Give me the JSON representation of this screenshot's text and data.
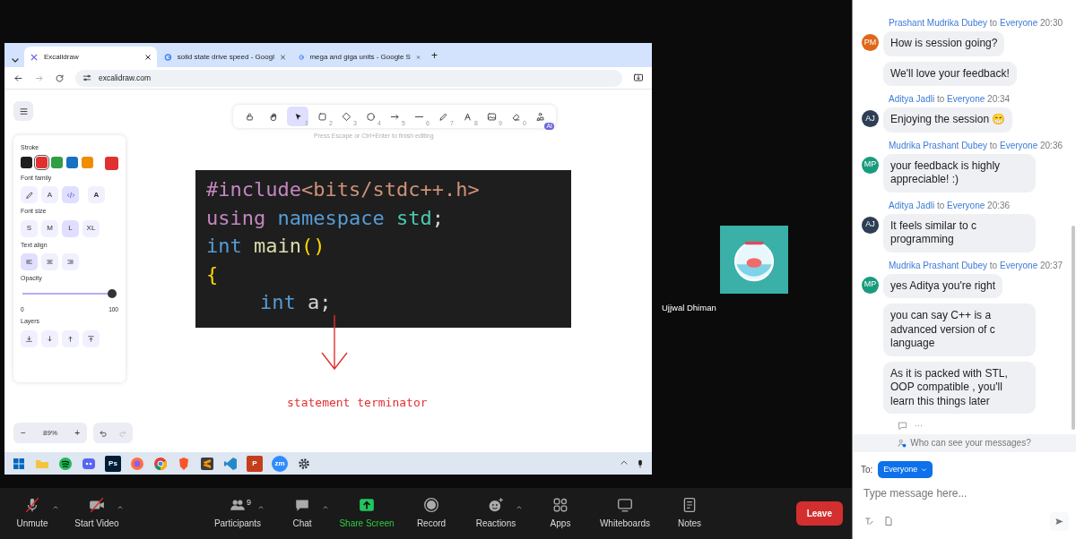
{
  "shared_screen": {
    "browser": {
      "tabs": [
        {
          "title": "Excalidraw",
          "selected": true
        },
        {
          "title": "solid state drive speed - Googl",
          "selected": false
        },
        {
          "title": "mega and giga units - Google S",
          "selected": false
        }
      ],
      "new_tab": "+",
      "url": "excalidraw.com"
    },
    "excalidraw": {
      "tools": [
        {
          "kind": "lock",
          "selected": false
        },
        {
          "kind": "hand",
          "selected": false
        },
        {
          "kind": "select",
          "key": "1",
          "selected": true
        },
        {
          "kind": "rectangle",
          "key": "2",
          "selected": false
        },
        {
          "kind": "diamond",
          "key": "3",
          "selected": false
        },
        {
          "kind": "ellipse",
          "key": "4",
          "selected": false
        },
        {
          "kind": "arrow",
          "key": "5",
          "selected": false
        },
        {
          "kind": "line",
          "key": "6",
          "selected": false
        },
        {
          "kind": "pencil",
          "key": "7",
          "selected": false
        },
        {
          "kind": "text",
          "key": "8",
          "selected": false
        },
        {
          "kind": "image",
          "key": "9",
          "selected": false
        },
        {
          "kind": "eraser",
          "key": "0",
          "selected": false
        },
        {
          "kind": "shapes",
          "badge": "AI",
          "selected": false
        }
      ],
      "hint": "Press Escape or Ctrl+Enter to finish editing",
      "properties": {
        "stroke_label": "Stroke",
        "stroke_colors": [
          {
            "color": "#1e1e1e",
            "selected": false
          },
          {
            "color": "#e03131",
            "selected": true
          },
          {
            "color": "#2f9e44",
            "selected": false
          },
          {
            "color": "#1971c2",
            "selected": false
          },
          {
            "color": "#f08c00",
            "selected": false
          }
        ],
        "current_color": {
          "color": "#e03131"
        },
        "font_family_label": "Font family",
        "font_families": [
          {
            "kind": "pencil",
            "selected": false
          },
          {
            "kind": "glyph",
            "glyph": "A",
            "selected": false
          },
          {
            "kind": "code",
            "selected": true
          },
          {
            "kind": "glyph-bold",
            "glyph": "A",
            "selected": false
          }
        ],
        "font_size_label": "Font size",
        "font_sizes": [
          {
            "label": "S",
            "selected": false
          },
          {
            "label": "M",
            "selected": false
          },
          {
            "label": "L",
            "selected": true
          },
          {
            "label": "XL",
            "selected": false
          }
        ],
        "text_align_label": "Text align",
        "text_aligns": [
          {
            "kind": "left",
            "selected": true
          },
          {
            "kind": "center",
            "selected": false
          },
          {
            "kind": "right",
            "selected": false
          }
        ],
        "opacity_label": "Opacity",
        "opacity": {
          "level": 1.0,
          "min": "0",
          "max": "100"
        },
        "layers_label": "Layers",
        "layers": [
          {
            "kind": "to-back"
          },
          {
            "kind": "backward"
          },
          {
            "kind": "forward"
          },
          {
            "kind": "to-front"
          }
        ]
      },
      "zoom": {
        "minus": "−",
        "value": "89%",
        "plus": "+"
      },
      "code_lines": [
        {
          "indented": false,
          "tokens": [
            {
              "text": "#include",
              "color": "#c586c0"
            },
            {
              "text": "<bits/stdc++.h>",
              "color": "#ce9178"
            }
          ]
        },
        {
          "indented": false,
          "tokens": [
            {
              "text": "using ",
              "color": "#c586c0"
            },
            {
              "text": "namespace ",
              "color": "#569cd6"
            },
            {
              "text": "std",
              "color": "#4ec9b0"
            },
            {
              "text": ";",
              "color": "#d4d4d4"
            }
          ]
        },
        {
          "indented": false,
          "tokens": [
            {
              "text": "int ",
              "color": "#569cd6"
            },
            {
              "text": "main",
              "color": "#dcdcaa"
            },
            {
              "text": "()",
              "color": "#ffd700"
            }
          ]
        },
        {
          "indented": false,
          "tokens": [
            {
              "text": "{",
              "color": "#ffd700"
            }
          ]
        },
        {
          "indented": true,
          "tokens": [
            {
              "text": "int ",
              "color": "#569cd6"
            },
            {
              "text": "a",
              "color": "#d4d4d4"
            },
            {
              "text": ";",
              "color": "#d4d4d4"
            }
          ]
        }
      ],
      "annotation": "statement terminator"
    },
    "taskbar": [
      {
        "kind": "windows"
      },
      {
        "kind": "folder"
      },
      {
        "kind": "spotify"
      },
      {
        "kind": "discord"
      },
      {
        "kind": "tile",
        "label": "Ps",
        "color": "#001e36"
      },
      {
        "kind": "firefox"
      },
      {
        "kind": "chrome"
      },
      {
        "kind": "brave"
      },
      {
        "kind": "sublime"
      },
      {
        "kind": "vscode"
      },
      {
        "kind": "tile",
        "label": "P",
        "color": "#c43e1c"
      },
      {
        "kind": "circle",
        "label": "zm",
        "color": "#2d8cff"
      },
      {
        "kind": "gear"
      }
    ]
  },
  "video_tile": {
    "name": "Ujjwal Dhiman"
  },
  "controls": [
    {
      "kind": "mic-off",
      "label": "Unmute",
      "caret": true
    },
    {
      "kind": "video-off",
      "label": "Start Video",
      "caret": true
    },
    {
      "kind": "participants",
      "label": "Participants",
      "count": "9",
      "caret": true
    },
    {
      "kind": "chat",
      "label": "Chat",
      "caret": true
    },
    {
      "kind": "share",
      "label": "Share Screen",
      "caret": false
    },
    {
      "kind": "record",
      "label": "Record",
      "caret": false
    },
    {
      "kind": "reactions",
      "label": "Reactions",
      "caret": true
    },
    {
      "kind": "apps",
      "label": "Apps",
      "caret": false
    },
    {
      "kind": "whiteboards",
      "label": "Whiteboards",
      "caret": false
    },
    {
      "kind": "notes",
      "label": "Notes",
      "caret": false
    }
  ],
  "leave_button": "Leave",
  "chat": {
    "groups": [
      {
        "sender": "Prashant Mudrika Dubey",
        "to": "to",
        "recipient": "Everyone",
        "time": "20:30",
        "initials": "PM",
        "color": "#e0671a",
        "messages": [
          "How is session going?",
          "We'll love your feedback!"
        ]
      },
      {
        "sender": "Aditya Jadli",
        "to": "to",
        "recipient": "Everyone",
        "time": "20:34",
        "initials": "AJ",
        "color": "#2d3e55",
        "messages": [
          "Enjoying the session 😁"
        ]
      },
      {
        "sender": "Mudrika Prashant Dubey",
        "to": "to",
        "recipient": "Everyone",
        "time": "20:36",
        "initials": "MP",
        "color": "#199b7e",
        "messages": [
          "your feedback is highly appreciable! :)"
        ]
      },
      {
        "sender": "Aditya Jadli",
        "to": "to",
        "recipient": "Everyone",
        "time": "20:36",
        "initials": "AJ",
        "color": "#2d3e55",
        "messages": [
          "It feels similar to c programming"
        ]
      },
      {
        "sender": "Mudrika Prashant Dubey",
        "to": "to",
        "recipient": "Everyone",
        "time": "20:37",
        "initials": "MP",
        "color": "#199b7e",
        "messages": [
          "yes Aditya you're right",
          "you can say C++ is a advanced version of c language",
          "As it is packed with STL, OOP compatible , you'll learn this things later"
        ]
      }
    ],
    "more": "···",
    "privacy": "Who can see your messages?",
    "to_label": "To:",
    "recipient": "Everyone",
    "placeholder": "Type message here..."
  }
}
